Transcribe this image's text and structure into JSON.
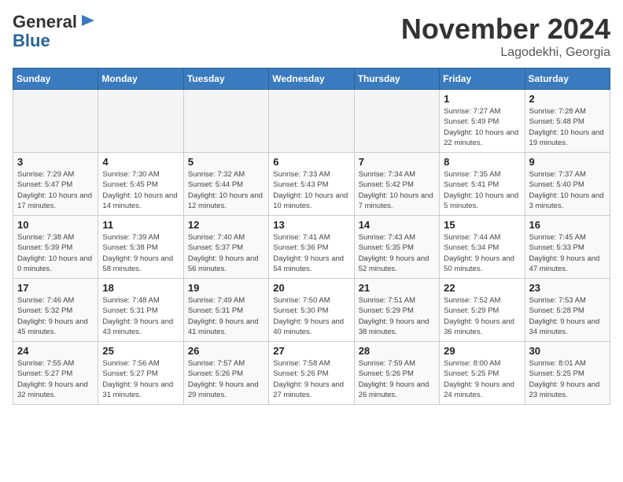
{
  "header": {
    "logo_general": "General",
    "logo_blue": "Blue",
    "month_title": "November 2024",
    "location": "Lagodekhi, Georgia"
  },
  "weekdays": [
    "Sunday",
    "Monday",
    "Tuesday",
    "Wednesday",
    "Thursday",
    "Friday",
    "Saturday"
  ],
  "weeks": [
    [
      {
        "day": "",
        "info": ""
      },
      {
        "day": "",
        "info": ""
      },
      {
        "day": "",
        "info": ""
      },
      {
        "day": "",
        "info": ""
      },
      {
        "day": "",
        "info": ""
      },
      {
        "day": "1",
        "info": "Sunrise: 7:27 AM\nSunset: 5:49 PM\nDaylight: 10 hours and 22 minutes."
      },
      {
        "day": "2",
        "info": "Sunrise: 7:28 AM\nSunset: 5:48 PM\nDaylight: 10 hours and 19 minutes."
      }
    ],
    [
      {
        "day": "3",
        "info": "Sunrise: 7:29 AM\nSunset: 5:47 PM\nDaylight: 10 hours and 17 minutes."
      },
      {
        "day": "4",
        "info": "Sunrise: 7:30 AM\nSunset: 5:45 PM\nDaylight: 10 hours and 14 minutes."
      },
      {
        "day": "5",
        "info": "Sunrise: 7:32 AM\nSunset: 5:44 PM\nDaylight: 10 hours and 12 minutes."
      },
      {
        "day": "6",
        "info": "Sunrise: 7:33 AM\nSunset: 5:43 PM\nDaylight: 10 hours and 10 minutes."
      },
      {
        "day": "7",
        "info": "Sunrise: 7:34 AM\nSunset: 5:42 PM\nDaylight: 10 hours and 7 minutes."
      },
      {
        "day": "8",
        "info": "Sunrise: 7:35 AM\nSunset: 5:41 PM\nDaylight: 10 hours and 5 minutes."
      },
      {
        "day": "9",
        "info": "Sunrise: 7:37 AM\nSunset: 5:40 PM\nDaylight: 10 hours and 3 minutes."
      }
    ],
    [
      {
        "day": "10",
        "info": "Sunrise: 7:38 AM\nSunset: 5:39 PM\nDaylight: 10 hours and 0 minutes."
      },
      {
        "day": "11",
        "info": "Sunrise: 7:39 AM\nSunset: 5:38 PM\nDaylight: 9 hours and 58 minutes."
      },
      {
        "day": "12",
        "info": "Sunrise: 7:40 AM\nSunset: 5:37 PM\nDaylight: 9 hours and 56 minutes."
      },
      {
        "day": "13",
        "info": "Sunrise: 7:41 AM\nSunset: 5:36 PM\nDaylight: 9 hours and 54 minutes."
      },
      {
        "day": "14",
        "info": "Sunrise: 7:43 AM\nSunset: 5:35 PM\nDaylight: 9 hours and 52 minutes."
      },
      {
        "day": "15",
        "info": "Sunrise: 7:44 AM\nSunset: 5:34 PM\nDaylight: 9 hours and 50 minutes."
      },
      {
        "day": "16",
        "info": "Sunrise: 7:45 AM\nSunset: 5:33 PM\nDaylight: 9 hours and 47 minutes."
      }
    ],
    [
      {
        "day": "17",
        "info": "Sunrise: 7:46 AM\nSunset: 5:32 PM\nDaylight: 9 hours and 45 minutes."
      },
      {
        "day": "18",
        "info": "Sunrise: 7:48 AM\nSunset: 5:31 PM\nDaylight: 9 hours and 43 minutes."
      },
      {
        "day": "19",
        "info": "Sunrise: 7:49 AM\nSunset: 5:31 PM\nDaylight: 9 hours and 41 minutes."
      },
      {
        "day": "20",
        "info": "Sunrise: 7:50 AM\nSunset: 5:30 PM\nDaylight: 9 hours and 40 minutes."
      },
      {
        "day": "21",
        "info": "Sunrise: 7:51 AM\nSunset: 5:29 PM\nDaylight: 9 hours and 38 minutes."
      },
      {
        "day": "22",
        "info": "Sunrise: 7:52 AM\nSunset: 5:29 PM\nDaylight: 9 hours and 36 minutes."
      },
      {
        "day": "23",
        "info": "Sunrise: 7:53 AM\nSunset: 5:28 PM\nDaylight: 9 hours and 34 minutes."
      }
    ],
    [
      {
        "day": "24",
        "info": "Sunrise: 7:55 AM\nSunset: 5:27 PM\nDaylight: 9 hours and 32 minutes."
      },
      {
        "day": "25",
        "info": "Sunrise: 7:56 AM\nSunset: 5:27 PM\nDaylight: 9 hours and 31 minutes."
      },
      {
        "day": "26",
        "info": "Sunrise: 7:57 AM\nSunset: 5:26 PM\nDaylight: 9 hours and 29 minutes."
      },
      {
        "day": "27",
        "info": "Sunrise: 7:58 AM\nSunset: 5:26 PM\nDaylight: 9 hours and 27 minutes."
      },
      {
        "day": "28",
        "info": "Sunrise: 7:59 AM\nSunset: 5:26 PM\nDaylight: 9 hours and 26 minutes."
      },
      {
        "day": "29",
        "info": "Sunrise: 8:00 AM\nSunset: 5:25 PM\nDaylight: 9 hours and 24 minutes."
      },
      {
        "day": "30",
        "info": "Sunrise: 8:01 AM\nSunset: 5:25 PM\nDaylight: 9 hours and 23 minutes."
      }
    ]
  ]
}
